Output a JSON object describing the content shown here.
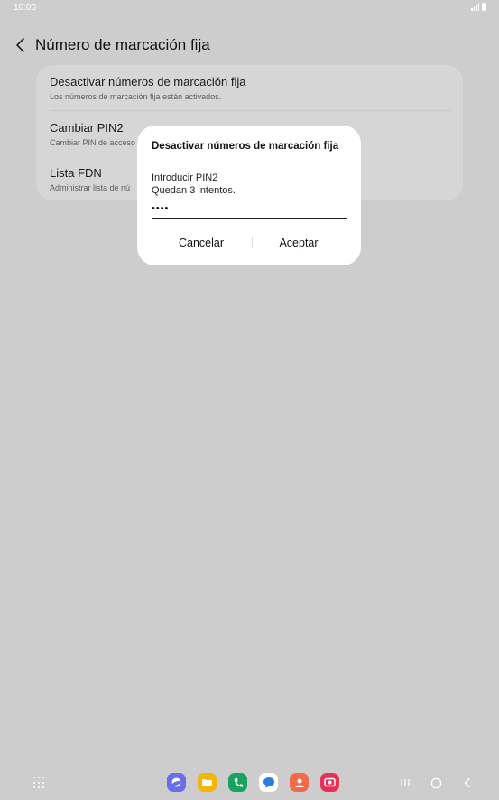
{
  "status_bar": {
    "time": "10:00"
  },
  "header": {
    "title": "Número de marcación fija",
    "back_icon": "chevron-left-icon"
  },
  "settings": {
    "items": [
      {
        "title": "Desactivar números de marcación fija",
        "subtitle": "Los números de marcación fija están activados."
      },
      {
        "title": "Cambiar PIN2",
        "subtitle": "Cambiar PIN de acceso"
      },
      {
        "title": "Lista FDN",
        "subtitle": "Administrar lista de nú"
      }
    ]
  },
  "dialog": {
    "title": "Desactivar números de marcación fija",
    "prompt": "Introducir PIN2",
    "attempts": "Quedan 3 intentos.",
    "pin_value": "••••",
    "cancel_label": "Cancelar",
    "accept_label": "Aceptar"
  },
  "dock": {
    "apps": [
      {
        "name": "internet",
        "color": "#6a6ee8"
      },
      {
        "name": "my-files",
        "color": "#f4b400"
      },
      {
        "name": "phone",
        "color": "#1aa260"
      },
      {
        "name": "messages",
        "color": "#2a7de1"
      },
      {
        "name": "contacts",
        "color": "#f26a4b"
      },
      {
        "name": "screen-recorder",
        "color": "#e8315a"
      }
    ]
  },
  "colors": {
    "background": "#cdcdcd",
    "card": "#d6d6d6",
    "dialog": "#ffffff"
  }
}
